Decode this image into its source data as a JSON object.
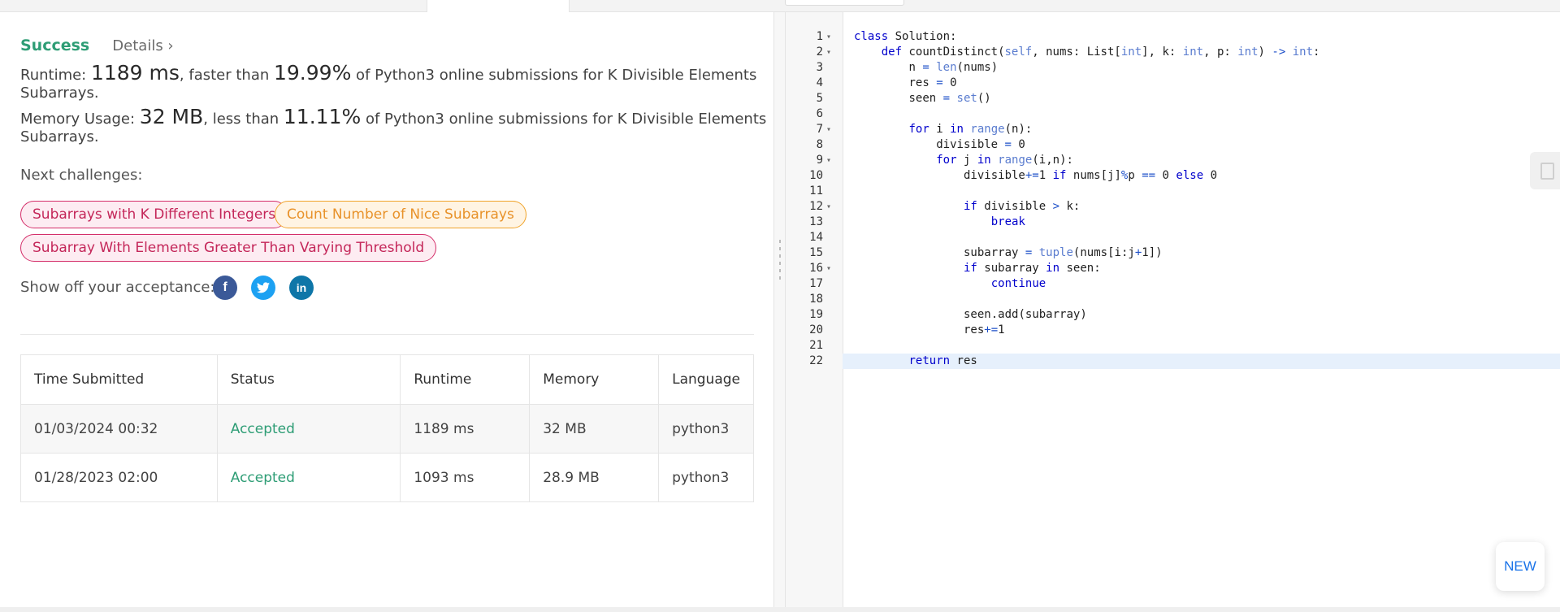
{
  "result": {
    "status": "Success",
    "details_label": "Details ›",
    "runtime_prefix": "Runtime: ",
    "runtime_value": "1189 ms",
    "runtime_mid": ", faster than ",
    "runtime_pct": "19.99%",
    "runtime_suffix": " of Python3 online submissions for K Divisible Elements Subarrays.",
    "memory_prefix": "Memory Usage: ",
    "memory_value": "32 MB",
    "memory_mid": ", less than ",
    "memory_pct": "11.11%",
    "memory_suffix": " of Python3 online submissions for K Divisible Elements Subarrays."
  },
  "next": {
    "label": "Next challenges:",
    "items": [
      {
        "label": "Subarrays with K Different Integers",
        "difficulty": "hard"
      },
      {
        "label": "Count Number of Nice Subarrays",
        "difficulty": "medium"
      },
      {
        "label": "Subarray With Elements Greater Than Varying Threshold",
        "difficulty": "hard"
      }
    ]
  },
  "share": {
    "label": "Show off your acceptance:",
    "icons": [
      "facebook-icon",
      "twitter-icon",
      "linkedin-icon"
    ]
  },
  "table": {
    "headers": [
      "Time Submitted",
      "Status",
      "Runtime",
      "Memory",
      "Language"
    ],
    "rows": [
      [
        "01/03/2024 00:32",
        "Accepted",
        "1189 ms",
        "32 MB",
        "python3"
      ],
      [
        "01/28/2023 02:00",
        "Accepted",
        "1093 ms",
        "28.9 MB",
        "python3"
      ]
    ]
  },
  "editor": {
    "lines": [
      "class Solution:",
      "    def countDistinct(self, nums: List[int], k: int, p: int) -> int:",
      "        n = len(nums)",
      "        res = 0",
      "        seen = set()",
      "",
      "        for i in range(n):",
      "            divisible = 0",
      "            for j in range(i,n):",
      "                divisible+=1 if nums[j]%p == 0 else 0",
      "",
      "                if divisible > k:",
      "                    break",
      "",
      "                subarray = tuple(nums[i:j+1])",
      "                if subarray in seen:",
      "                    continue",
      "",
      "                seen.add(subarray)",
      "                res+=1",
      "",
      "        return res"
    ],
    "fold_lines": [
      1,
      2,
      7,
      9,
      12,
      16
    ],
    "active_line": 22
  },
  "new_button": "NEW",
  "colors": {
    "success": "#2e9d75",
    "hard": "#d42f6a",
    "medium": "#f0a42c",
    "facebook": "#3b5998",
    "twitter": "#1da1f2",
    "linkedin": "#0e76a8",
    "new": "#1a73e8"
  }
}
